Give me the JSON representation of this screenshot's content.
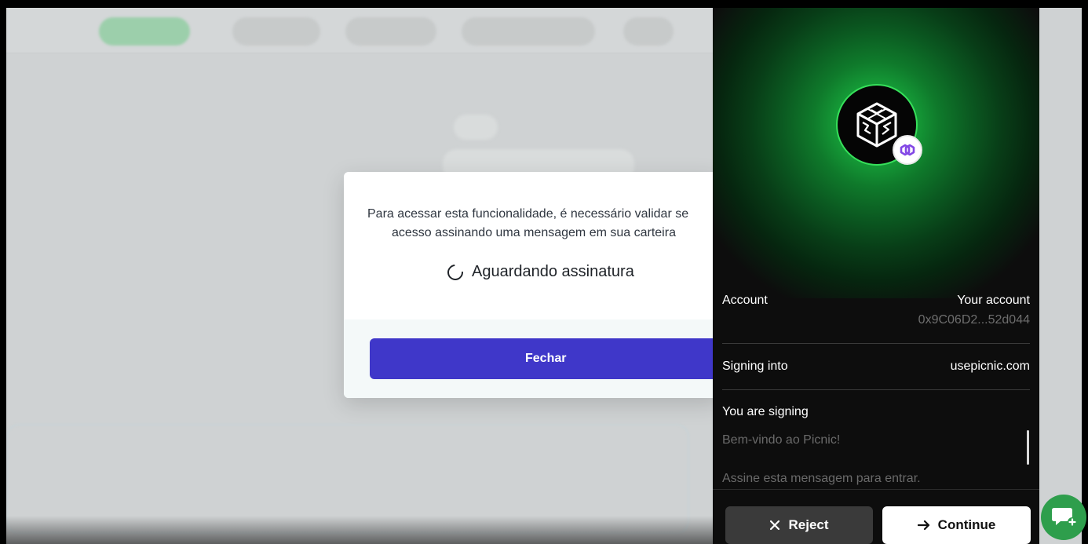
{
  "modal": {
    "message_line1": "Para acessar esta funcionalidade, é necessário validar se",
    "message_line2": "acesso assinando uma mensagem em sua carteira",
    "status": "Aguardando assinatura",
    "close_label": "Fechar"
  },
  "wallet": {
    "account_label": "Account",
    "account_name": "Your account",
    "account_address": "0x9C06D2...52d044",
    "signing_into_label": "Signing into",
    "signing_into_value": "usepicnic.com",
    "you_are_signing_label": "You are signing",
    "message_lines": [
      "Bem-vindo ao Picnic!",
      "Assine esta mensagem para entrar."
    ],
    "reject_label": "Reject",
    "continue_label": "Continue"
  },
  "colors": {
    "primary_button": "#3f37c9",
    "wallet_bg": "#0d0d0d",
    "accent_green": "#36e05a",
    "chat_fab": "#2e9e4c"
  },
  "icons": {
    "logo": "cube-logo-icon",
    "chain": "polygon-chain-icon",
    "spinner": "loading-spinner-icon",
    "reject": "close-x-icon",
    "continue": "arrow-right-icon",
    "chat": "chat-support-icon"
  }
}
